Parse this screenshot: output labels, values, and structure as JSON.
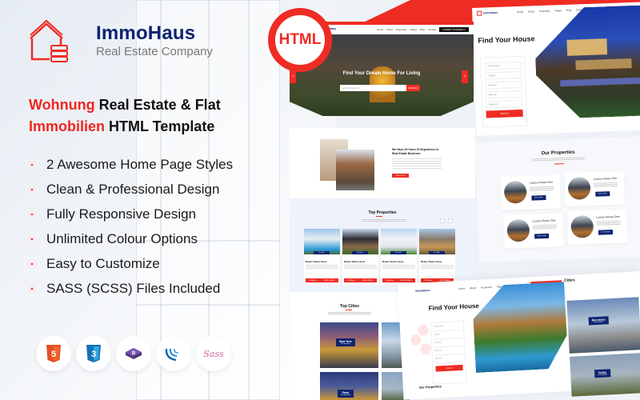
{
  "brand": {
    "name": "ImmoHaus",
    "tagline": "Real Estate Company",
    "accent_color": "#ef2c24",
    "navy_color": "#0d2470"
  },
  "headline": {
    "line1_highlight": "Wohnung",
    "line1_rest": " Real Estate & Flat",
    "line2_highlight": "Immobilien",
    "line2_rest": " HTML Template"
  },
  "features": [
    "2 Awesome Home Page Styles",
    "Clean & Professional Design",
    "Fully Responsive Design",
    "Unlimited Colour Options",
    "Easy to Customize",
    "SASS (SCSS) Files Included"
  ],
  "tech_icons": [
    {
      "name": "html5-icon",
      "label": "5"
    },
    {
      "name": "css3-icon",
      "label": "3"
    },
    {
      "name": "bootstrap-icon",
      "label": "B"
    },
    {
      "name": "jquery-icon",
      "label": ""
    },
    {
      "name": "sass-icon",
      "label": "Sass"
    }
  ],
  "badge": {
    "label": "HTML"
  },
  "mockup_home1": {
    "nav_items": [
      "Home",
      "About",
      "Properties",
      "Pages",
      "Blog",
      "Contact"
    ],
    "cta": "SUBMIT PROPERTY",
    "hero_title": "Find Your Dream Home For Living",
    "search_placeholder": "Search Keyword",
    "search_button": "SEARCH"
  },
  "mockup_home2": {
    "nav_items": [
      "Home",
      "About",
      "Properties",
      "Pages",
      "Blog",
      "Contact"
    ],
    "cta": "SUBMIT PROPERTY",
    "title": "Find Your House",
    "fields": [
      "Property Type",
      "Location",
      "Sub Area",
      "Bedroom",
      "Bathroom"
    ],
    "button": "SEARCH"
  },
  "mockup_about": {
    "title": "We Have 25 Years Of Experience In Real Estate Business",
    "button": "READ MORE",
    "top_properties_title": "Top Properties",
    "cards": [
      {
        "tag": "For Sale",
        "name": "Modern Duplex House",
        "btn1": "$6,800/mo",
        "btn2": "VIEW DETAILS"
      },
      {
        "tag": "For Rent",
        "name": "Modern Duplex House",
        "btn1": "$6,800/mo",
        "btn2": "VIEW DETAILS"
      },
      {
        "tag": "For Sale",
        "name": "Modern Duplex House",
        "btn1": "$6,800/mo",
        "btn2": "VIEW DETAILS"
      },
      {
        "tag": "For Sale",
        "name": "Modern Duplex House",
        "btn1": "$6,800/mo",
        "btn2": "VIEW DETAILS"
      }
    ]
  },
  "mockup_our_properties": {
    "title": "Our Properties",
    "cards": [
      {
        "name": "Luxury House One",
        "button": "More Details"
      },
      {
        "name": "Luxury House One",
        "button": "More Details"
      },
      {
        "name": "Luxury House One",
        "button": "More Details"
      },
      {
        "name": "Luxury House One",
        "button": "More Details"
      }
    ]
  },
  "mockup_cities": {
    "title": "Top Cities",
    "cities": [
      {
        "name": "New York",
        "count": "05 Properties"
      },
      {
        "name": "Paris",
        "count": "05 Properties"
      }
    ]
  },
  "mockup_home2_bottom": {
    "title": "Find Your House",
    "fields": [
      "Property Type",
      "Location",
      "Sub Area",
      "Bedroom",
      "Bathroom"
    ],
    "button": "SEARCH",
    "cities_title": "Cities",
    "cities": [
      {
        "name": "Barcelona",
        "count": "05 Properties"
      },
      {
        "name": "Dubai",
        "count": "05 Properties"
      }
    ],
    "our_properties": "Our Properties"
  }
}
